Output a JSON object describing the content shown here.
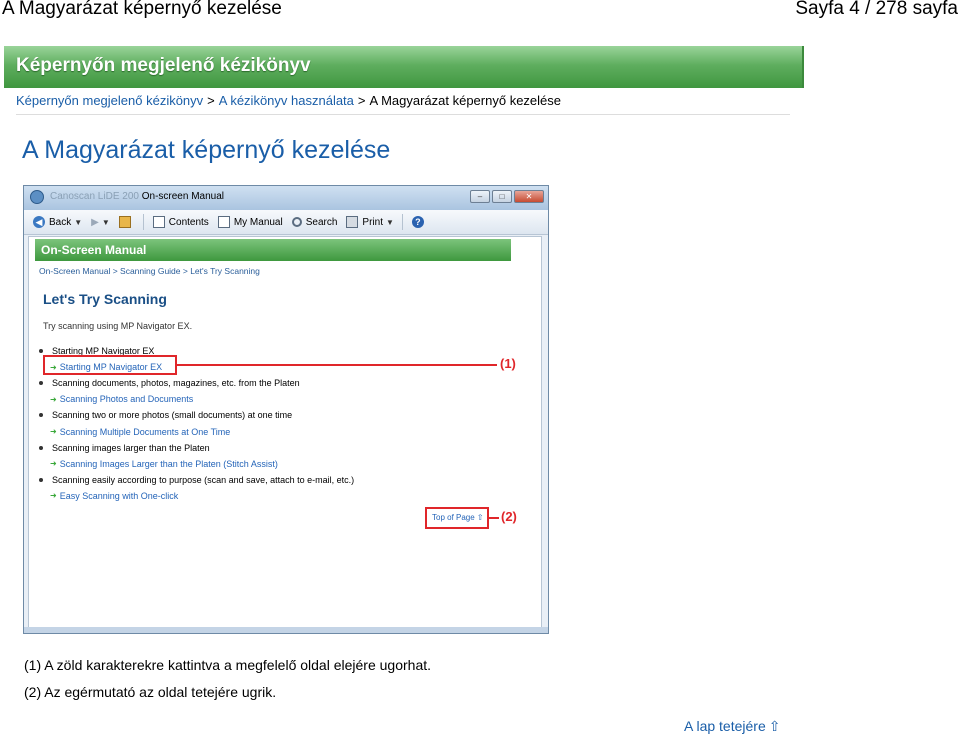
{
  "header": {
    "title": "A Magyarázat képernyő kezelése",
    "page_indicator": "Sayfa 4 / 278 sayfa"
  },
  "banner": {
    "title": "Képernyőn megjelenő kézikönyv"
  },
  "breadcrumb": {
    "items": [
      "Képernyőn megjelenő kézikönyv",
      "A kézikönyv használata"
    ],
    "separator": ">",
    "current": "A Magyarázat képernyő kezelése"
  },
  "page_title": "A Magyarázat képernyő kezelése",
  "screenshot": {
    "window_title": "On-screen Manual",
    "window_title_blurred": "Canoscan LiDE 200",
    "toolbar": {
      "back": "Back",
      "contents": "Contents",
      "my_manual": "My Manual",
      "search": "Search",
      "print": "Print"
    },
    "inner_banner": "On-Screen Manual",
    "inner_breadcrumb": "On-Screen Manual > Scanning Guide > Let's Try Scanning",
    "inner_heading": "Let's Try Scanning",
    "inner_intro": "Try scanning using MP Navigator EX.",
    "list": [
      {
        "type": "topic",
        "text": "Starting MP Navigator EX"
      },
      {
        "type": "link",
        "text": "Starting MP Navigator EX"
      },
      {
        "type": "topic",
        "text": "Scanning documents, photos, magazines, etc. from the Platen"
      },
      {
        "type": "link",
        "text": "Scanning Photos and Documents"
      },
      {
        "type": "topic",
        "text": "Scanning two or more photos (small documents) at one time"
      },
      {
        "type": "link",
        "text": "Scanning Multiple Documents at One Time"
      },
      {
        "type": "topic",
        "text": "Scanning images larger than the Platen"
      },
      {
        "type": "link",
        "text": "Scanning Images Larger than the Platen (Stitch Assist)"
      },
      {
        "type": "topic",
        "text": "Scanning easily according to purpose (scan and save, attach to e-mail, etc.)"
      },
      {
        "type": "link",
        "text": "Easy Scanning with One-click"
      }
    ],
    "top_of_page": "Top of Page",
    "callout_1": "(1)",
    "callout_2": "(2)"
  },
  "notes": [
    "(1) A zöld karakterekre kattintva a megfelelő oldal elejére ugorhat.",
    "(2) Az egérmutató az oldal tetejére ugrik."
  ],
  "top_link": "A lap tetejére",
  "icons": [
    "back-icon",
    "forward-icon",
    "home-icon",
    "contents-icon",
    "my-manual-icon",
    "search-icon",
    "print-icon",
    "help-icon",
    "up-arrow-icon"
  ],
  "colors": {
    "banner_green": "#4ea64e",
    "link_blue": "#1a5ea8",
    "callout_red": "#e0262a"
  }
}
